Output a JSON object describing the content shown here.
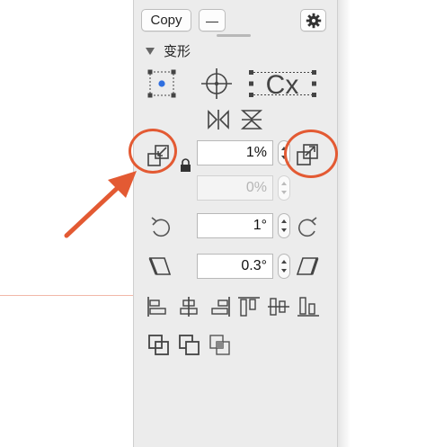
{
  "toolbar": {
    "copy_label": "Copy",
    "minus_label": "—",
    "gear_icon": "gear-icon"
  },
  "transform": {
    "title": "变形",
    "scale": {
      "value": "1%"
    },
    "scale_secondary": {
      "value": "0%"
    },
    "rotation": {
      "value": "1°"
    },
    "skew": {
      "value": "0.3°"
    }
  },
  "icons": [
    "selection-bounds-icon",
    "crosshair-icon",
    "cx-text-icon",
    "flip-horizontal-icon",
    "flip-vertical-icon",
    "scale-down-icon",
    "lock-icon",
    "scale-up-icon",
    "rotate-ccw-icon",
    "rotate-cw-icon",
    "skew-left-icon",
    "skew-right-icon",
    "align-left-icon",
    "align-center-icon",
    "align-right-icon",
    "align-top-icon",
    "align-middle-icon",
    "align-bottom-icon",
    "boolean-union-icon",
    "boolean-subtract-icon",
    "boolean-intersect-icon"
  ],
  "colors": {
    "panel_bg": "#ececec",
    "annotation": "#e35a33",
    "accent_dot": "#2f6fe0"
  }
}
